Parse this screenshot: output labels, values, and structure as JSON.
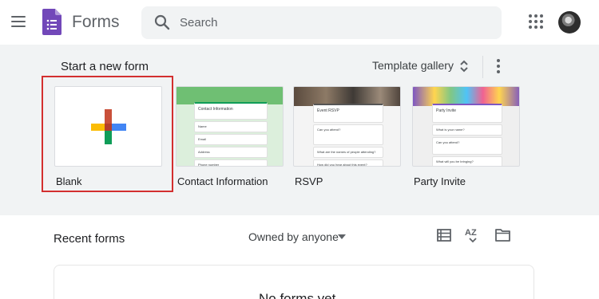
{
  "app": {
    "title": "Forms",
    "brand_color": "#7248b9"
  },
  "search": {
    "placeholder": "Search"
  },
  "icons": {
    "menu": "hamburger-menu-icon",
    "logo": "forms-logo-icon",
    "search": "magnifier-icon",
    "apps": "grid-apps-icon",
    "avatar": "account-avatar",
    "gallery_toggle": "unfold-more-icon",
    "more": "more-vert-icon",
    "owner_caret": "arrow-drop-down-icon",
    "list_view": "list-view-icon",
    "sort": "sort-az-icon",
    "folder": "folder-icon"
  },
  "templates_section": {
    "title": "Start a new form",
    "gallery_label": "Template gallery",
    "items": [
      {
        "label": "Blank",
        "highlighted": true
      },
      {
        "label": "Contact Information"
      },
      {
        "label": "RSVP"
      },
      {
        "label": "Party Invite"
      }
    ],
    "thumbnails": {
      "contact": {
        "heading": "Contact Information",
        "fields": [
          "Name",
          "Email",
          "Address",
          "Phone number"
        ]
      },
      "rsvp": {
        "heading": "Event RSVP",
        "fields": [
          "Can you attend?",
          "What are the names of people attending?",
          "How did you hear about this event?"
        ]
      },
      "party": {
        "heading": "Party Invite",
        "fields": [
          "What is your name?",
          "Can you attend?",
          "What will you be bringing?"
        ]
      }
    },
    "highlight_color": "#d32f2f"
  },
  "recent": {
    "title": "Recent forms",
    "owner_filter": "Owned by anyone",
    "sort_label": "AZ",
    "empty_text": "No forms yet"
  }
}
